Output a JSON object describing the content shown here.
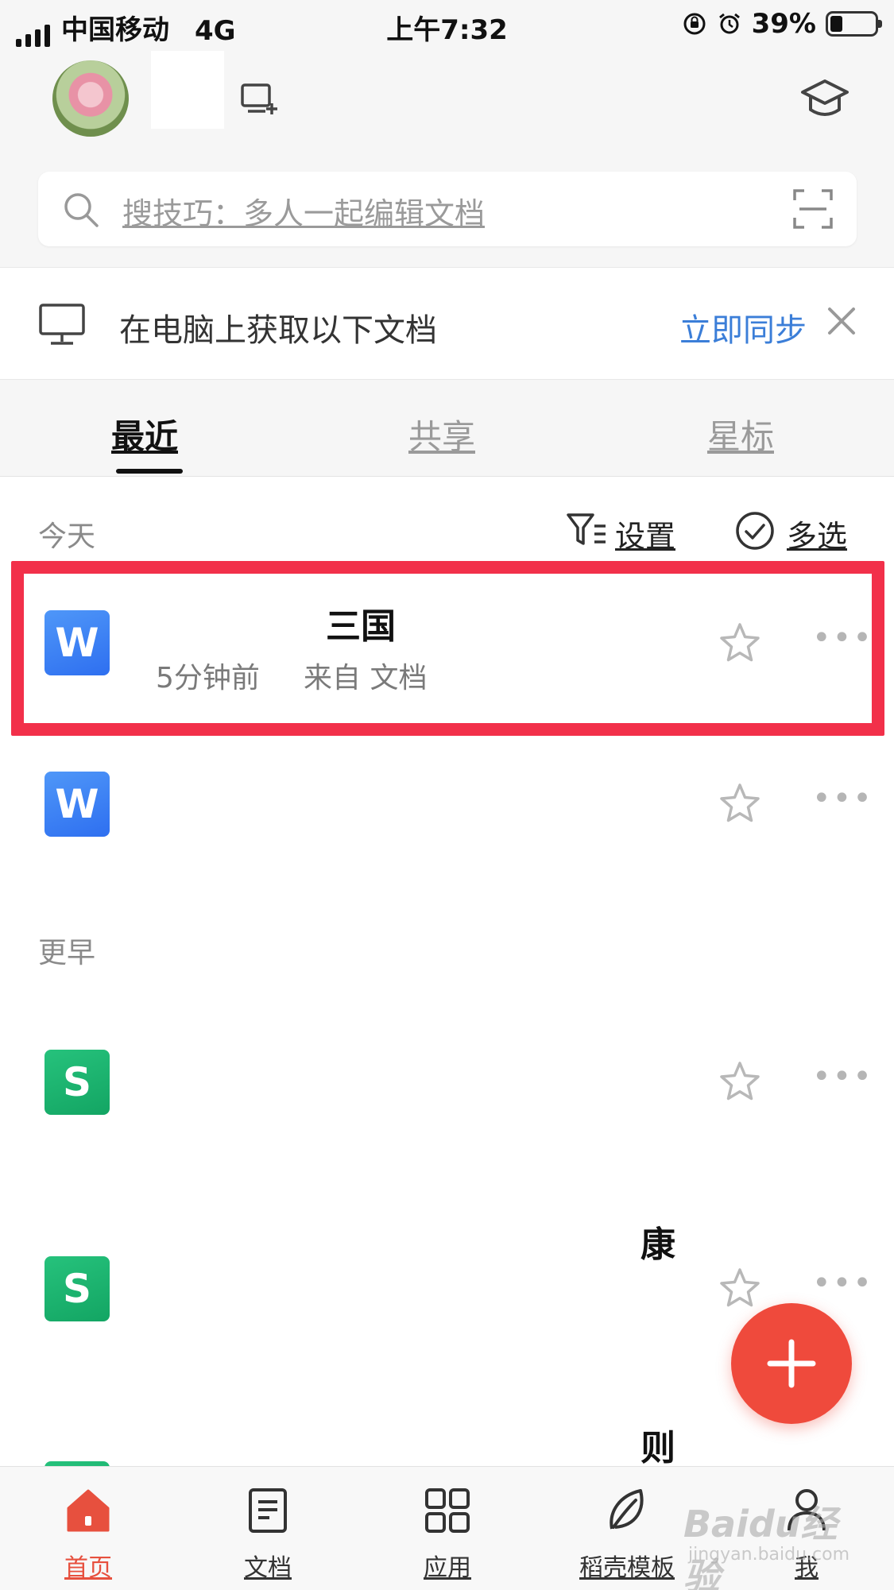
{
  "status_bar": {
    "carrier": "中国移动",
    "network": "4G",
    "time": "上午7:32",
    "battery": "39%",
    "battery_level": 0.39
  },
  "header": {
    "icons": [
      "avatar",
      "device-add-icon",
      "graduation-hat-icon"
    ]
  },
  "search": {
    "placeholder": "搜技巧：多人一起编辑文档",
    "icons": [
      "search-icon",
      "scan-icon"
    ]
  },
  "sync_banner": {
    "message": "在电脑上获取以下文档",
    "action": "立即同步"
  },
  "tabs": [
    {
      "label": "最近",
      "active": true
    },
    {
      "label": "共享",
      "active": false
    },
    {
      "label": "星标",
      "active": false
    }
  ],
  "sections": {
    "today": "今天",
    "earlier": "更早"
  },
  "toolbar": {
    "settings": "设置",
    "multi_select": "多选"
  },
  "files": [
    {
      "type": "W",
      "title": "三国",
      "meta": "来自 文档",
      "time": "5分钟前",
      "highlighted": true
    },
    {
      "type": "W",
      "title": "",
      "meta": ""
    },
    {
      "type": "S",
      "title": "",
      "meta": ""
    },
    {
      "type": "S",
      "title": "康",
      "meta": ""
    },
    {
      "type": "S",
      "title": "则",
      "meta": ""
    }
  ],
  "fab": {
    "icon": "plus-icon"
  },
  "bottom_nav": [
    {
      "label": "首页",
      "icon": "home-icon",
      "active": true
    },
    {
      "label": "文档",
      "icon": "document-icon",
      "active": false
    },
    {
      "label": "应用",
      "icon": "apps-grid-icon",
      "active": false
    },
    {
      "label": "稻壳模板",
      "icon": "leaf-icon",
      "active": false
    },
    {
      "label": "我",
      "icon": "person-icon",
      "active": false
    }
  ],
  "watermark": {
    "brand": "Baidu经验",
    "url": "jingyan.baidu.com"
  },
  "colors": {
    "accent_red": "#ef4a3c",
    "highlight_red": "#f2304a",
    "link_blue": "#3b7ed8",
    "writer_blue": "#3a84f4",
    "sheet_green": "#1db46f"
  }
}
